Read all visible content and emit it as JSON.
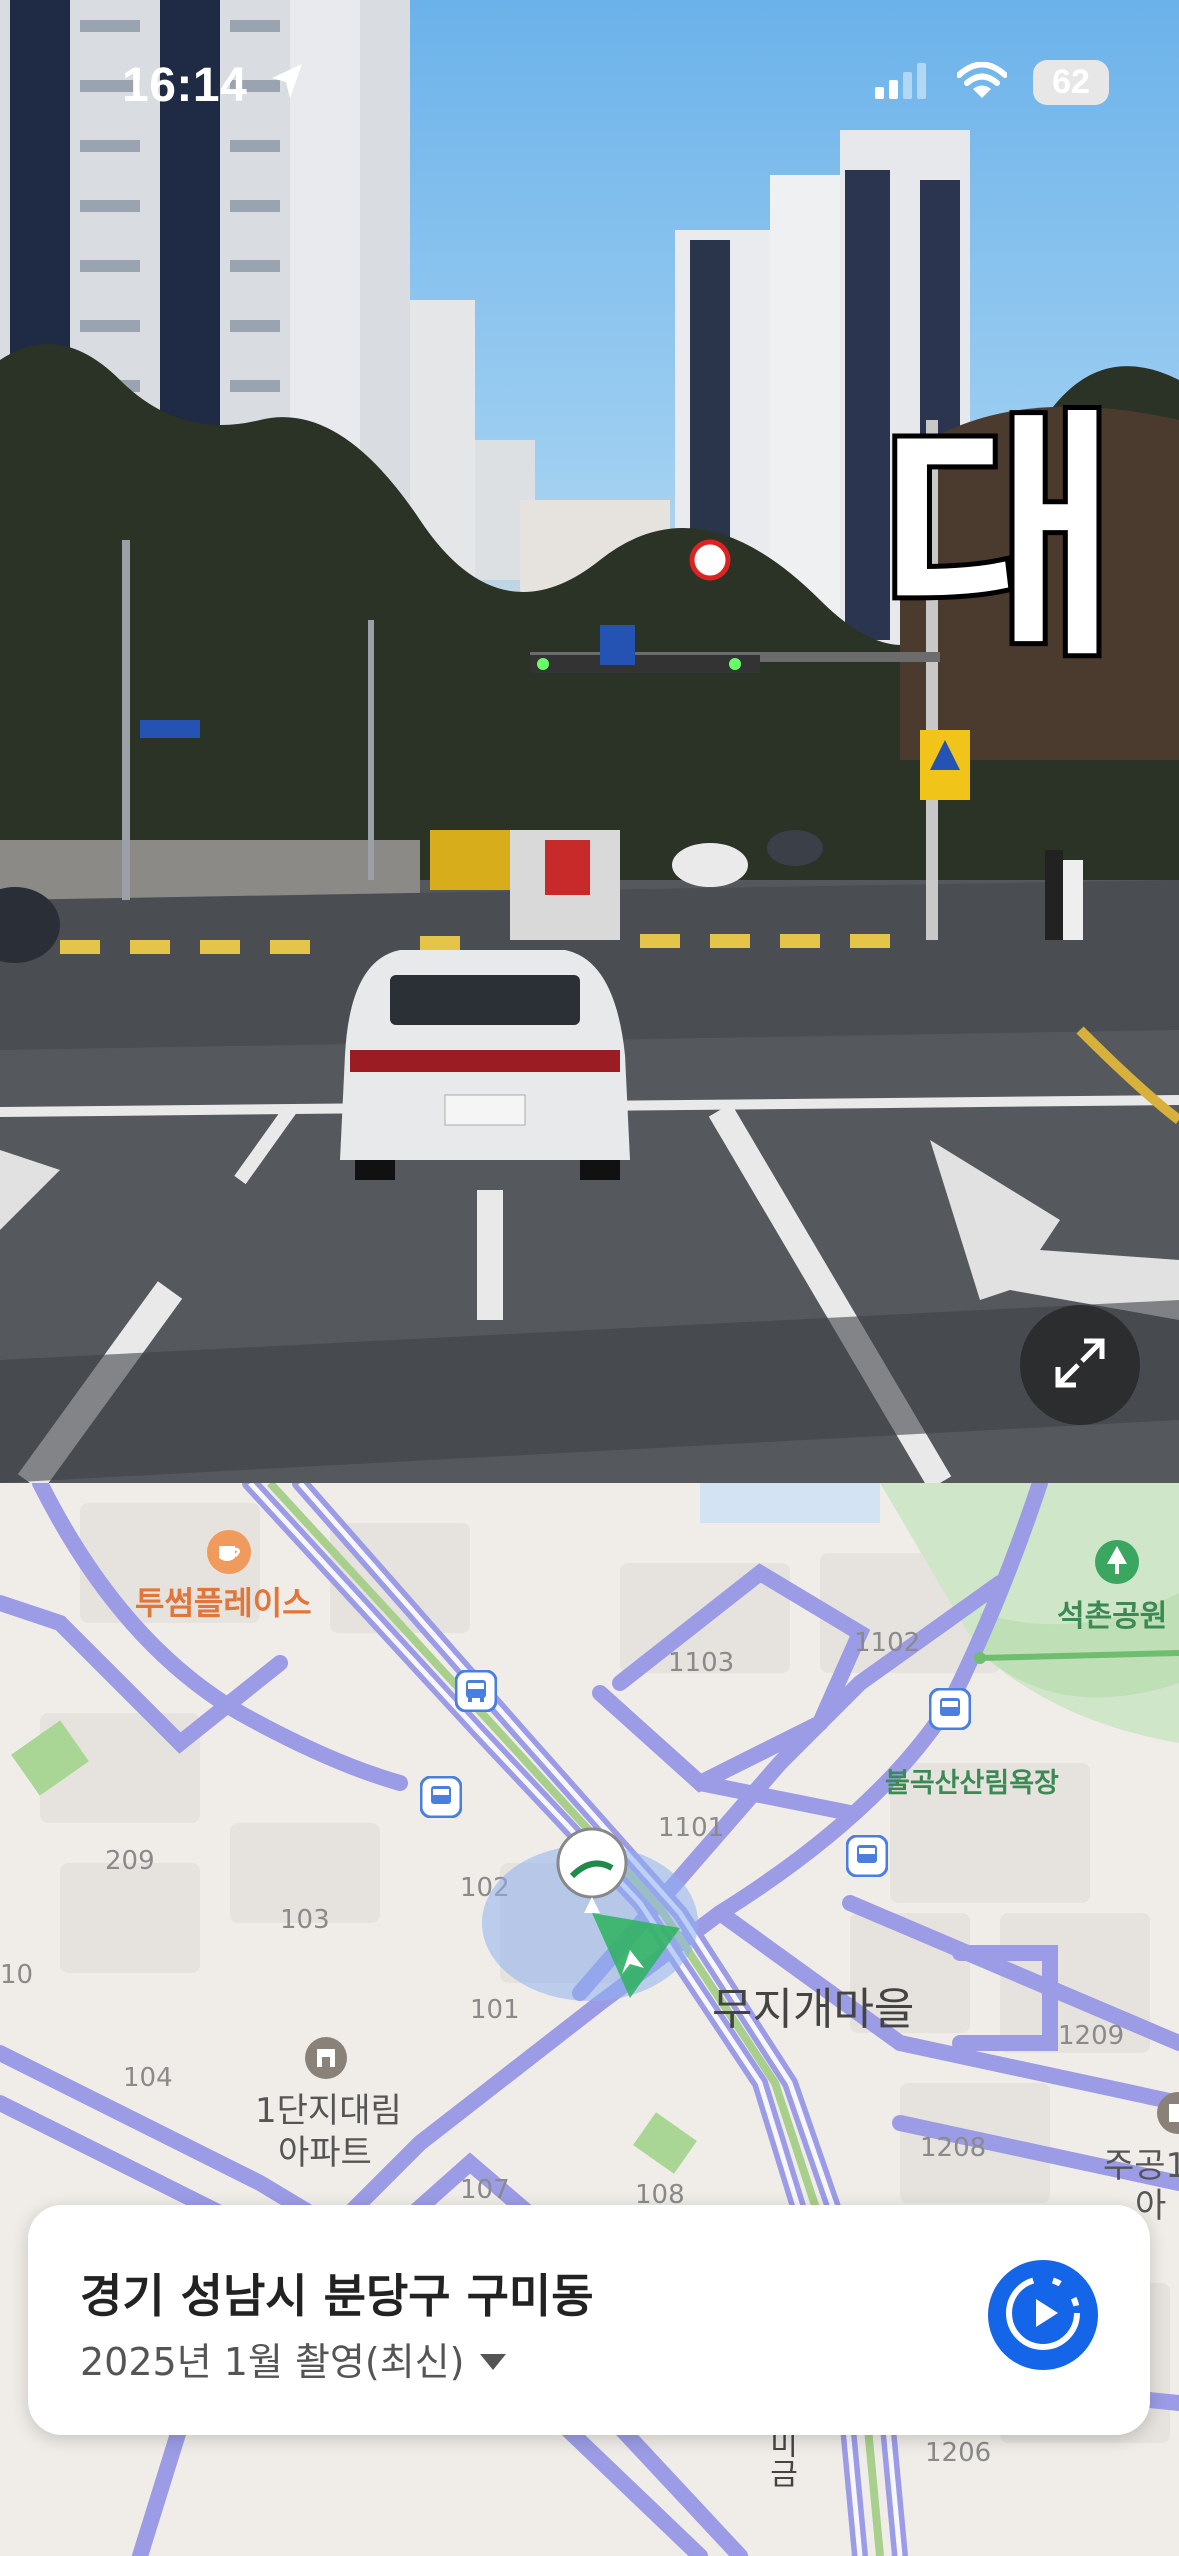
{
  "status_bar": {
    "time": "16:14",
    "battery": "62",
    "icons": [
      "location-arrow-icon",
      "cellular-signal-icon",
      "wifi-icon",
      "battery-icon"
    ]
  },
  "street_view": {
    "sign_text": "대",
    "expand_icon": "expand-icon"
  },
  "map": {
    "pois": {
      "cafe": "투썸플레이스",
      "park": "석촌공원",
      "bath": "불곡산산림욕장",
      "apartment_line1": "1단지대림",
      "apartment_line2": "아파트",
      "village": "무지개마을",
      "jugong_line1": "주공1",
      "jugong_line2": "아"
    },
    "buildings": [
      "1103",
      "1102",
      "1101",
      "209",
      "103",
      "102",
      "101",
      "104",
      "10",
      "107",
      "108",
      "1209",
      "1208",
      "1206"
    ],
    "colors": {
      "road": "#9c9ce6",
      "park": "#c6e4c0",
      "marker": "#2db35d",
      "accuracy": "#8fb0f0"
    }
  },
  "card": {
    "title": "경기 성남시 분당구 구미동",
    "subtitle": "2025년 1월 촬영(최신)",
    "dropdown_icon": "caret-down-icon",
    "play_icon": "play-circle-icon",
    "accent": "#1565e8"
  }
}
